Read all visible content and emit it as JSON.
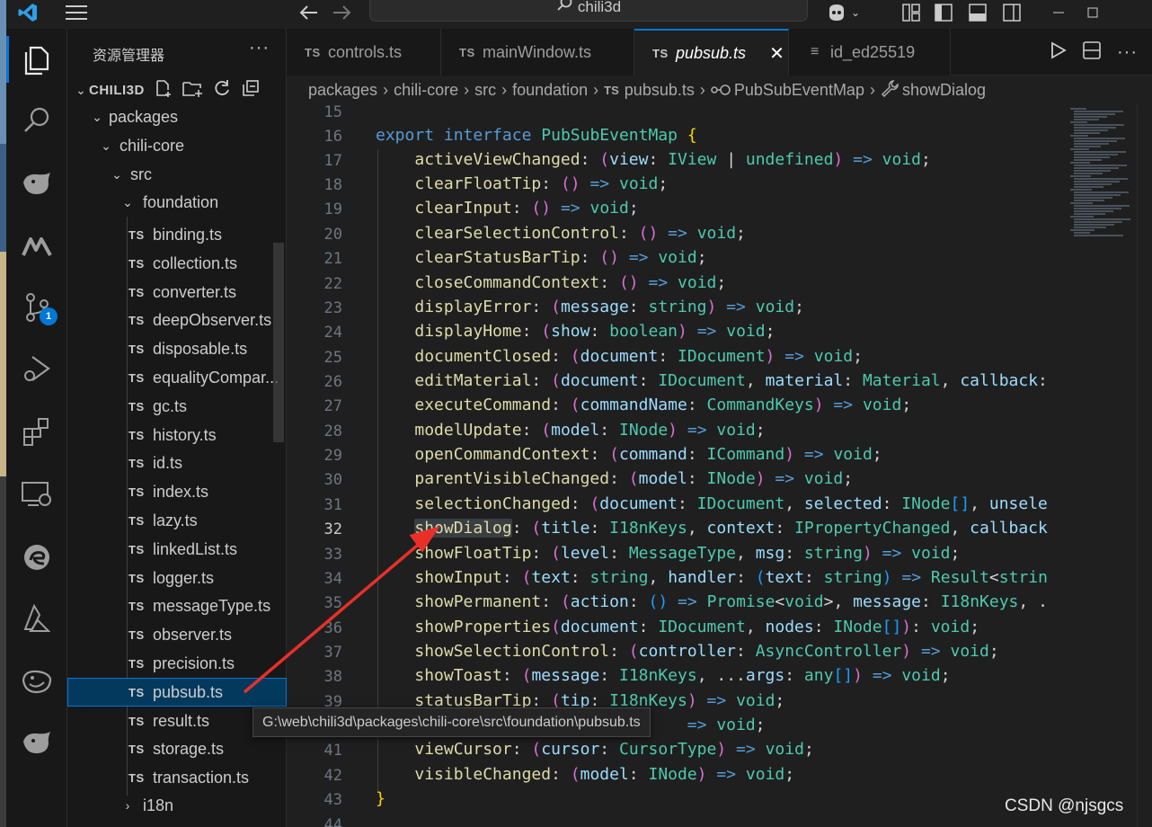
{
  "titlebar": {
    "search_text": "chili3d",
    "icons": [
      "vscode-logo-icon",
      "menu-icon",
      "back-arrow-icon",
      "forward-arrow-icon",
      "search-icon",
      "copilot-icon",
      "layout-icon",
      "sidebar-left-icon",
      "panel-icon",
      "sidebar-right-icon",
      "minimize-icon",
      "maximize-icon"
    ]
  },
  "activitybar": {
    "items": [
      "explorer-icon",
      "search-icon",
      "deepseek-icon",
      "marscode-icon",
      "source-control-icon",
      "run-debug-icon",
      "extensions-icon",
      "remote-explorer-icon",
      "edge-icon",
      "azure-icon",
      "whale-icon",
      "deepseek-chat-icon"
    ],
    "scm_badge": "1"
  },
  "sidebar": {
    "title": "资源管理器",
    "more": "···",
    "root": "CHILI3D",
    "tree": [
      {
        "label": "packages",
        "kind": "folder",
        "depth": 1
      },
      {
        "label": "chili-core",
        "kind": "folder",
        "depth": 2
      },
      {
        "label": "src",
        "kind": "folder",
        "depth": 3
      },
      {
        "label": "foundation",
        "kind": "folder",
        "depth": 4
      }
    ],
    "files_badge": "TS",
    "files": [
      "binding.ts",
      "collection.ts",
      "converter.ts",
      "deepObserver.ts",
      "disposable.ts",
      "equalityCompar...",
      "gc.ts",
      "history.ts",
      "id.ts",
      "index.ts",
      "lazy.ts",
      "linkedList.ts",
      "logger.ts",
      "messageType.ts",
      "observer.ts",
      "precision.ts",
      "pubsub.ts",
      "result.ts",
      "storage.ts",
      "transaction.ts"
    ],
    "selected_file": "pubsub.ts",
    "collapsed_folder": "i18n"
  },
  "tabs": [
    {
      "label": "controls.ts",
      "badge": "TS",
      "active": false
    },
    {
      "label": "mainWindow.ts",
      "badge": "TS",
      "active": false
    },
    {
      "label": "pubsub.ts",
      "badge": "TS",
      "active": true,
      "close": "✕"
    },
    {
      "label": "id_ed25519",
      "badge": "≡",
      "active": false
    }
  ],
  "breadcrumb": {
    "parts": [
      "packages",
      "chili-core",
      "src",
      "foundation"
    ],
    "file": "pubsub.ts",
    "file_badge": "TS",
    "symbol1": "PubSubEventMap",
    "symbol2": "showDialog"
  },
  "editor": {
    "line_numbers": [
      "15",
      "16",
      "17",
      "18",
      "19",
      "20",
      "21",
      "22",
      "23",
      "24",
      "25",
      "26",
      "27",
      "28",
      "29",
      "30",
      "31",
      "32",
      "33",
      "34",
      "35",
      "36",
      "37",
      "38",
      "39",
      "40",
      "41",
      "42",
      "43",
      "44"
    ],
    "current_line": "32"
  },
  "tooltip": {
    "text": "G:\\web\\chili3d\\packages\\chili-core\\src\\foundation\\pubsub.ts"
  },
  "watermark": "CSDN @njsgcs",
  "colors": {
    "accent": "#0078d4",
    "annotation_arrow": "#e8302a",
    "selection": "#04395e"
  }
}
